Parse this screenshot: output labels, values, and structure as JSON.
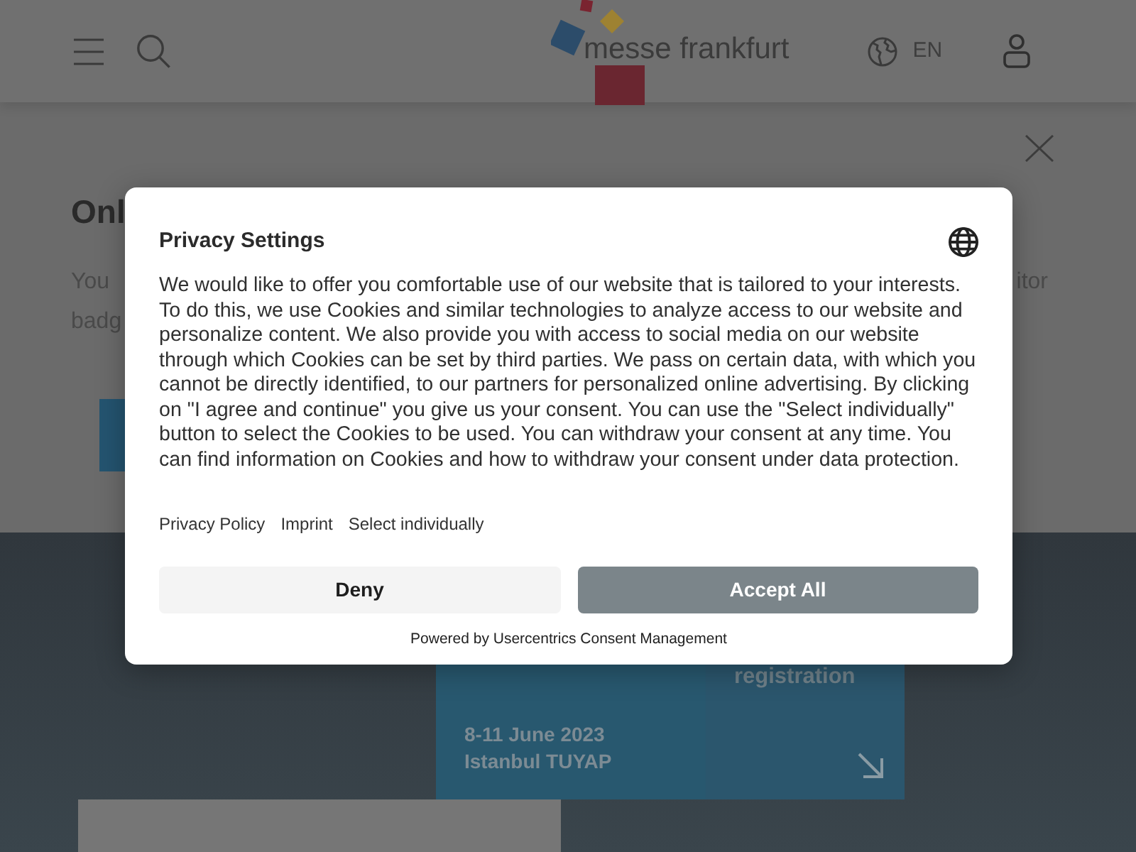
{
  "header": {
    "logo_text": "messe frankfurt",
    "language": "EN"
  },
  "page": {
    "heading": "Onl",
    "intro_lines": [
      "You",
      "badg"
    ],
    "intro_right": "itor"
  },
  "event_card": {
    "link_label": "registration",
    "date": "8-11 June 2023",
    "venue": "Istanbul TUYAP"
  },
  "consent_dialog": {
    "title": "Privacy Settings",
    "body": "We would like to offer you comfortable use of our website that is tailored to your interests. To do this, we use Cookies and similar technologies to analyze access to our website and personalize content. We also provide you with access to social media on our website through which Cookies can be set by third parties. We pass on certain data, with which you cannot be directly identified, to our partners for personalized online advertising. By clicking on \"I agree and continue\" you give us your consent. You can use the \"Select individually\" button to select the Cookies to be used. You can withdraw your consent at any time. You can find information on Cookies and how to withdraw your consent under data protection.",
    "links": [
      "Privacy Policy",
      "Imprint",
      "Select individually"
    ],
    "buttons": [
      {
        "label": "Deny",
        "kind": "secondary"
      },
      {
        "label": "Accept All",
        "kind": "primary"
      }
    ],
    "footer": "Powered by Usercentrics Consent Management"
  }
}
